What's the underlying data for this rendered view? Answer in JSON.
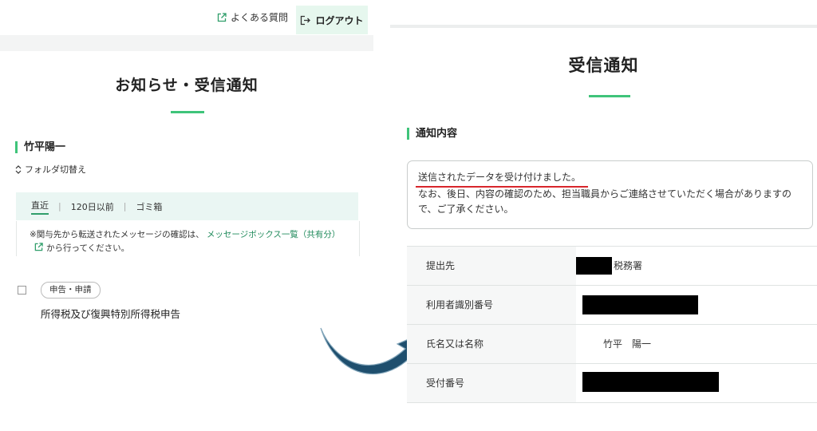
{
  "left": {
    "header": {
      "faq_label": "よくある質問",
      "logout_label": "ログアウト"
    },
    "page_title": "お知らせ・受信通知",
    "user_name": "竹平陽一",
    "folder_switch_label": "フォルダ切替え",
    "tabs": [
      {
        "label": "直近",
        "selected": true
      },
      {
        "label": "120日以前",
        "selected": false
      },
      {
        "label": "ゴミ箱",
        "selected": false
      }
    ],
    "tab_separator": "|",
    "note": {
      "prefix": "※関与先から転送されたメッセージの確認は、",
      "link_text": "メッセージボックス一覧（共有分）",
      "suffix": "から行ってください。"
    },
    "message_item": {
      "badge": "申告・申請",
      "title": "所得税及び復興特別所得税申告"
    }
  },
  "right": {
    "page_title": "受信通知",
    "section_title": "通知内容",
    "notice": {
      "line1": "送信されたデータを受け付けました。",
      "line2": "なお、後日、内容の確認のため、担当職員からご連絡させていただく場合がありますので、ご了承ください。"
    },
    "table": [
      {
        "label": "提出先",
        "value": "税務署",
        "redacted": true
      },
      {
        "label": "利用者識別番号",
        "value": "",
        "redacted": true
      },
      {
        "label": "氏名又は名称",
        "value": "竹平　陽一",
        "redacted": false
      },
      {
        "label": "受付番号",
        "value": "",
        "redacted": true
      }
    ]
  },
  "colors": {
    "accent_green": "#3fc47a",
    "link_green": "#1f8a5b",
    "logout_bg": "#e6f7ee",
    "tab_bg": "#eaf6f3",
    "arrow_navy": "#1f4f6e",
    "underline_red": "#d8262b"
  },
  "icons": {
    "faq": "external-link-icon",
    "logout": "logout-icon",
    "folder": "updown-chevron-icon",
    "note_link": "external-link-icon",
    "arrow": "curved-arrow-icon"
  }
}
